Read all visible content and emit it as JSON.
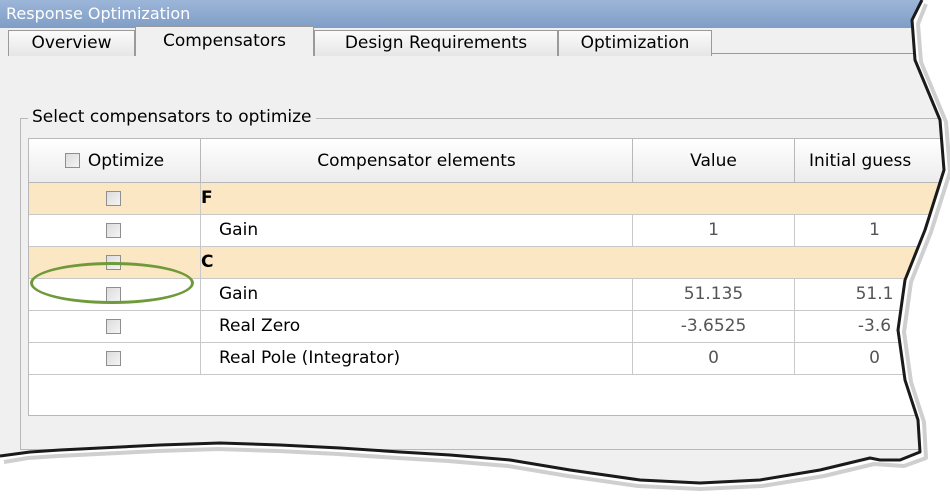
{
  "window": {
    "title": "Response Optimization"
  },
  "tabs": [
    {
      "label": "Overview"
    },
    {
      "label": "Compensators"
    },
    {
      "label": "Design Requirements"
    },
    {
      "label": "Optimization"
    }
  ],
  "group": {
    "label": "Select compensators to optimize"
  },
  "table": {
    "headers": {
      "optimize": "Optimize",
      "elements": "Compensator elements",
      "value": "Value",
      "initial": "Initial guess"
    },
    "rows": [
      {
        "type": "group",
        "name": "F",
        "checked": false
      },
      {
        "type": "item",
        "name": "Gain",
        "value": "1",
        "initial": "1",
        "checked": false
      },
      {
        "type": "group",
        "name": "C",
        "checked": false
      },
      {
        "type": "item",
        "name": "Gain",
        "value": "51.135",
        "initial": "51.1",
        "checked": false
      },
      {
        "type": "item",
        "name": "Real Zero",
        "value": "-3.6525",
        "initial": "-3.6",
        "checked": false
      },
      {
        "type": "item",
        "name": "Real Pole (Integrator)",
        "value": "0",
        "initial": "0",
        "checked": false
      }
    ]
  },
  "colors": {
    "title_bar": "#8aa6cf",
    "group_row": "#fbe7c4",
    "highlight": "#6f9a3a"
  }
}
